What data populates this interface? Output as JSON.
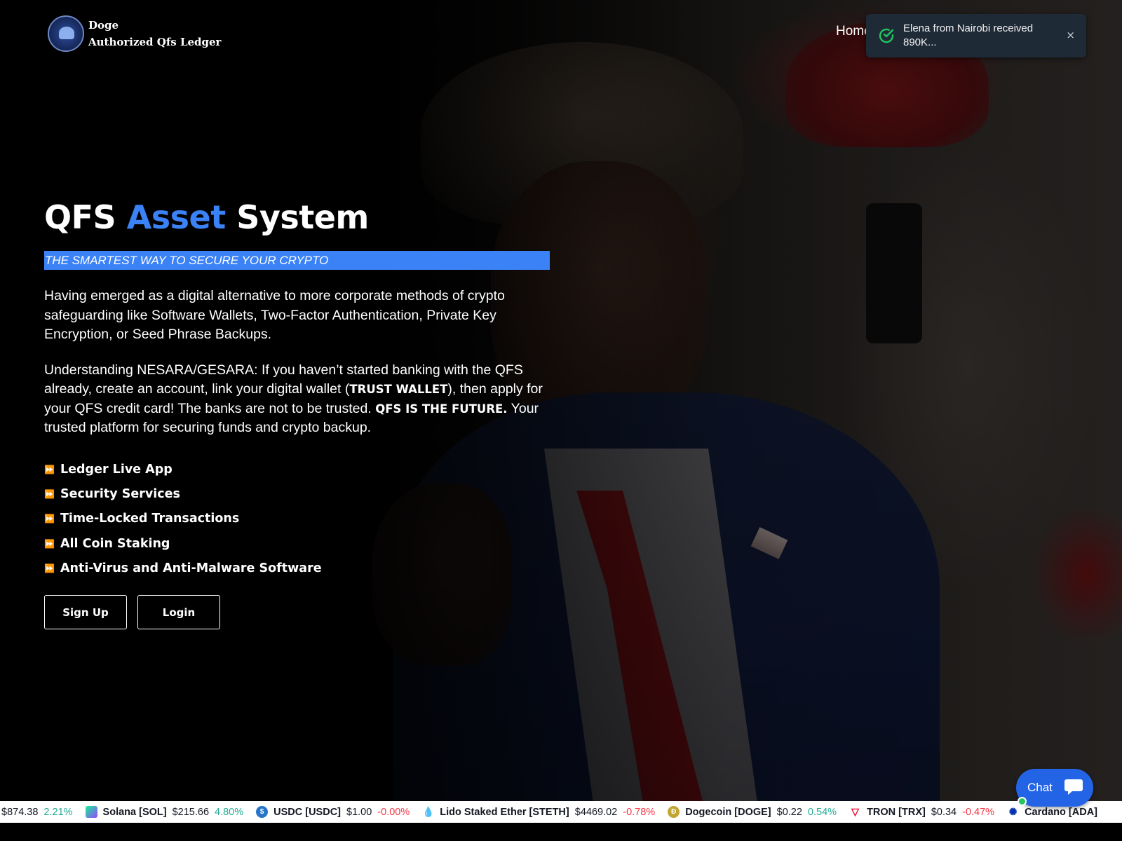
{
  "brand": {
    "line1": "Doge",
    "line2": "Authorized Qfs Ledger"
  },
  "nav": {
    "home": "Home"
  },
  "toast": {
    "message": "Elena from Nairobi received 890K...",
    "close": "×",
    "status_color": "#22c55e"
  },
  "hero": {
    "title_part1": "QFS ",
    "title_accent": "Asset",
    "title_part2": " System",
    "tagline": "THE SMARTEST WAY TO SECURE YOUR CRYPTO",
    "para1": "Having emerged as a digital alternative to more corporate methods of crypto safeguarding like Software Wallets, Two-Factor Authentication, Private Key Encryption, or Seed Phrase Backups.",
    "para2_a": "Understanding NESARA/GESARA: If you haven’t started banking with the QFS already, create an account, link your digital wallet (",
    "para2_b": "TRUST WALLET",
    "para2_c": "), then apply for your QFS credit card! The banks are not to be trusted. ",
    "para2_d": "QFS IS THE FUTURE.",
    "para2_e": " Your trusted platform for securing funds and crypto backup.",
    "accent_color": "#3b82f6",
    "features": [
      "Ledger Live App",
      "Security Services",
      "Time-Locked Transactions",
      "All Coin Staking",
      "Anti-Virus and Anti-Malware Software"
    ],
    "bullet": "⏩",
    "signup": "Sign Up",
    "login": "Login"
  },
  "ticker": [
    {
      "name": "",
      "price": "$874.38",
      "change": "2.21%",
      "dir": "up",
      "icon": "none",
      "color": "#000000"
    },
    {
      "name": "Solana [SOL]",
      "price": "$215.66",
      "change": "4.80%",
      "dir": "up",
      "icon": "solana-icon",
      "color": "#9945ff"
    },
    {
      "name": "USDC [USDC]",
      "price": "$1.00",
      "change": "-0.00%",
      "dir": "down",
      "icon": "usdc-icon",
      "color": "#2775ca"
    },
    {
      "name": "Lido Staked Ether [STETH]",
      "price": "$4469.02",
      "change": "-0.78%",
      "dir": "down",
      "icon": "steth-icon",
      "color": "#00a3ff"
    },
    {
      "name": "Dogecoin [DOGE]",
      "price": "$0.22",
      "change": "0.54%",
      "dir": "up",
      "icon": "doge-icon",
      "color": "#c2a633"
    },
    {
      "name": "TRON [TRX]",
      "price": "$0.34",
      "change": "-0.47%",
      "dir": "down",
      "icon": "tron-icon",
      "color": "#ef0027"
    },
    {
      "name": "Cardano [ADA]",
      "price": "",
      "change": "",
      "dir": "up",
      "icon": "cardano-icon",
      "color": "#0033ad"
    }
  ],
  "chat": {
    "label": "Chat"
  }
}
